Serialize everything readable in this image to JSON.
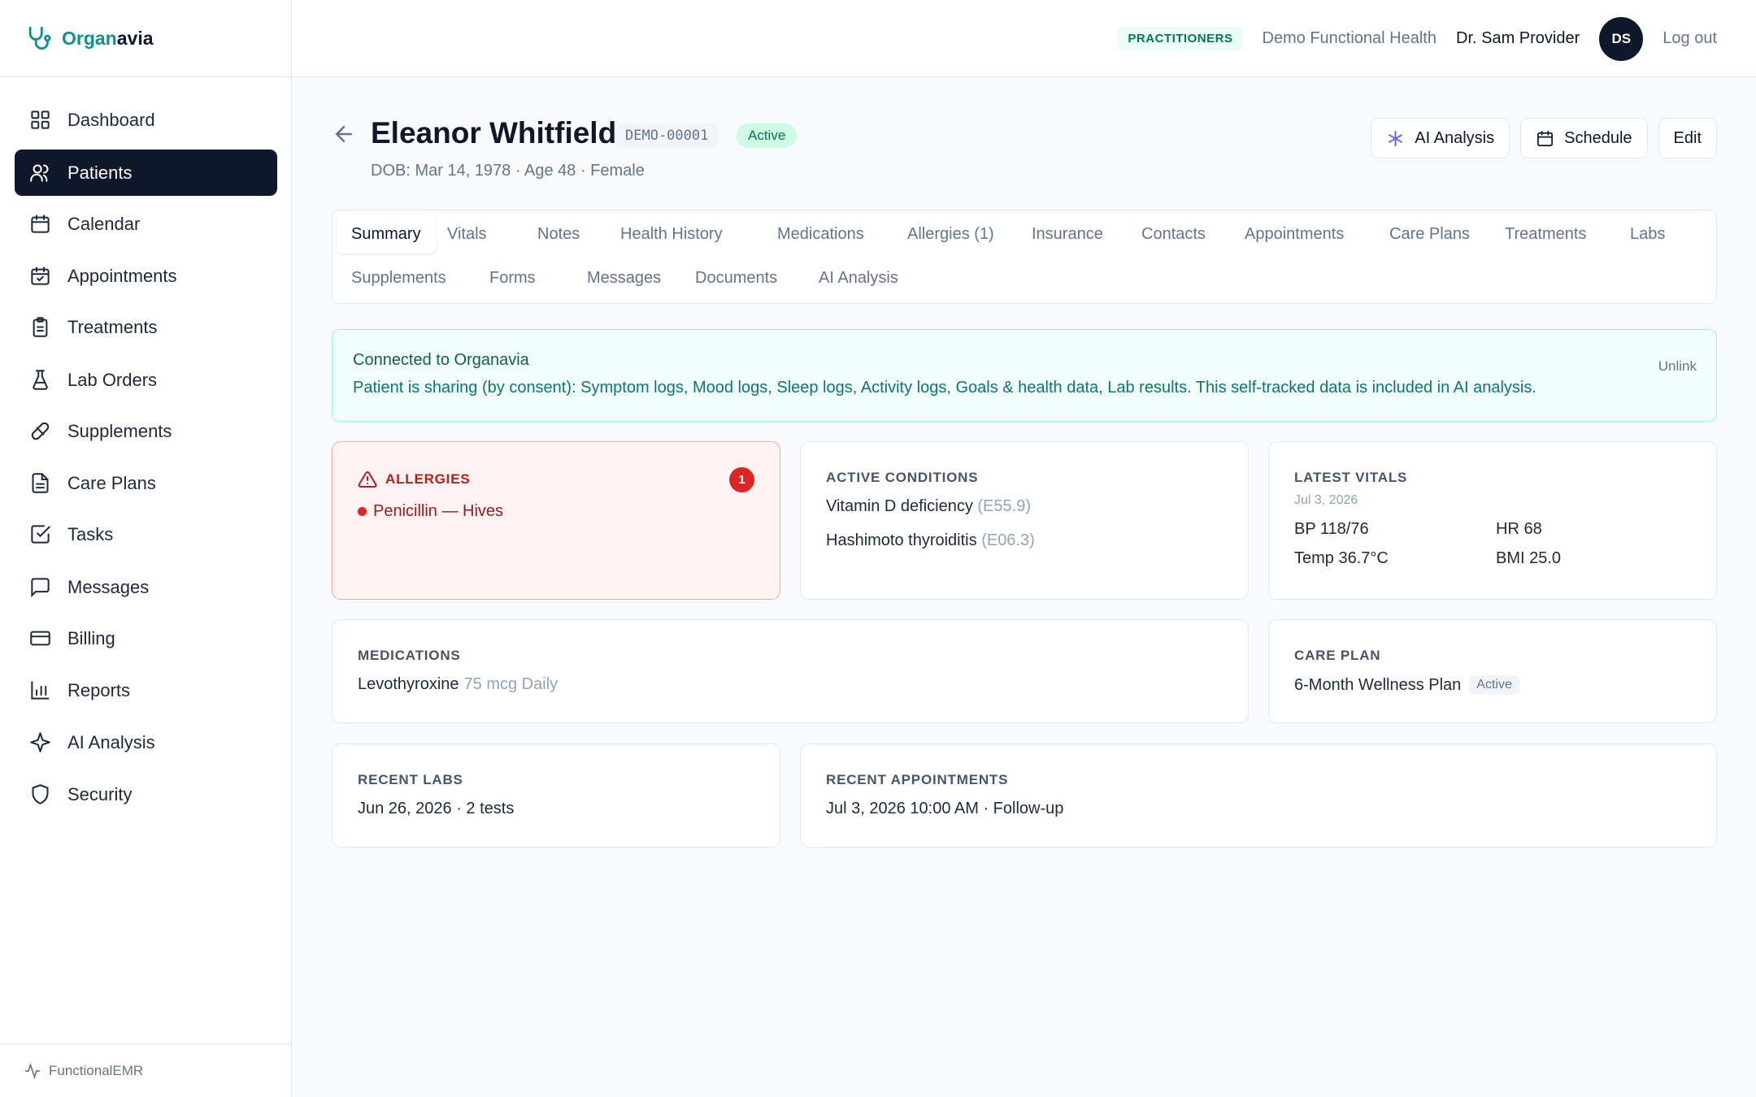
{
  "brand": {
    "name_part1": "Organ",
    "name_part2": "avia",
    "icon": "stethoscope-icon"
  },
  "sidebar": {
    "items": [
      {
        "label": "Dashboard",
        "icon": "grid-icon"
      },
      {
        "label": "Patients",
        "icon": "users-icon"
      },
      {
        "label": "Calendar",
        "icon": "calendar-icon"
      },
      {
        "label": "Appointments",
        "icon": "calendar-check-icon"
      },
      {
        "label": "Treatments",
        "icon": "clipboard-icon"
      },
      {
        "label": "Lab Orders",
        "icon": "flask-icon"
      },
      {
        "label": "Supplements",
        "icon": "pill-icon"
      },
      {
        "label": "Care Plans",
        "icon": "file-text-icon"
      },
      {
        "label": "Tasks",
        "icon": "check-square-icon"
      },
      {
        "label": "Messages",
        "icon": "message-icon"
      },
      {
        "label": "Billing",
        "icon": "credit-card-icon"
      },
      {
        "label": "Reports",
        "icon": "bar-chart-icon"
      },
      {
        "label": "AI Analysis",
        "icon": "sparkle-icon"
      },
      {
        "label": "Security",
        "icon": "shield-icon"
      }
    ],
    "active_index": 1,
    "footer": "FunctionalEMR"
  },
  "topbar": {
    "role_badge": "PRACTITIONERS",
    "org_name": "Demo Functional Health",
    "user_name": "Dr. Sam Provider",
    "avatar_initials": "DS",
    "logout_label": "Log out"
  },
  "patient": {
    "name": "Eleanor Whitfield",
    "id": "DEMO-00001",
    "status": "Active",
    "demographics": "DOB: Mar 14, 1978 · Age 48 · Female"
  },
  "actions": {
    "ai_analysis": "AI Analysis",
    "schedule": "Schedule",
    "edit": "Edit"
  },
  "tabs": [
    "Summary",
    "Vitals",
    "Notes",
    "Health History",
    "Medications",
    "Allergies (1)",
    "Insurance",
    "Contacts",
    "Appointments",
    "Care Plans",
    "Treatments",
    "Labs",
    "Supplements",
    "Forms",
    "Messages",
    "Documents",
    "AI Analysis"
  ],
  "active_tab": "Summary",
  "banner": {
    "title": "Connected to Organavia",
    "text": "Patient is sharing (by consent): Symptom logs, Mood logs, Sleep logs, Activity logs, Goals & health data, Lab results. This self-tracked data is included in AI analysis.",
    "unlink": "Unlink"
  },
  "allergies": {
    "label": "ALLERGIES",
    "count": "1",
    "items": [
      {
        "text": "Penicillin — Hives"
      }
    ]
  },
  "conditions": {
    "label": "ACTIVE CONDITIONS",
    "items": [
      {
        "name": "Vitamin D deficiency",
        "code": "(E55.9)"
      },
      {
        "name": "Hashimoto thyroiditis",
        "code": "(E06.3)"
      }
    ]
  },
  "vitals": {
    "label": "LATEST VITALS",
    "date": "Jul 3, 2026",
    "bp": "BP 118/76",
    "hr": "HR 68",
    "temp": "Temp 36.7°C",
    "bmi": "BMI 25.0"
  },
  "medications": {
    "label": "MEDICATIONS",
    "name": "Levothyroxine",
    "dose": "75 mcg Daily"
  },
  "care_plan": {
    "label": "CARE PLAN",
    "name": "6-Month Wellness Plan",
    "status": "Active"
  },
  "recent_labs": {
    "label": "RECENT LABS",
    "value": "Jun 26, 2026 · 2 tests"
  },
  "recent_appointments": {
    "label": "RECENT APPOINTMENTS",
    "value": "Jul 3, 2026 10:00 AM · Follow-up"
  },
  "colors": {
    "primary_dark": "#0f172a",
    "brand_teal": "#0d9488",
    "danger": "#dc2626",
    "success": "#047857"
  }
}
